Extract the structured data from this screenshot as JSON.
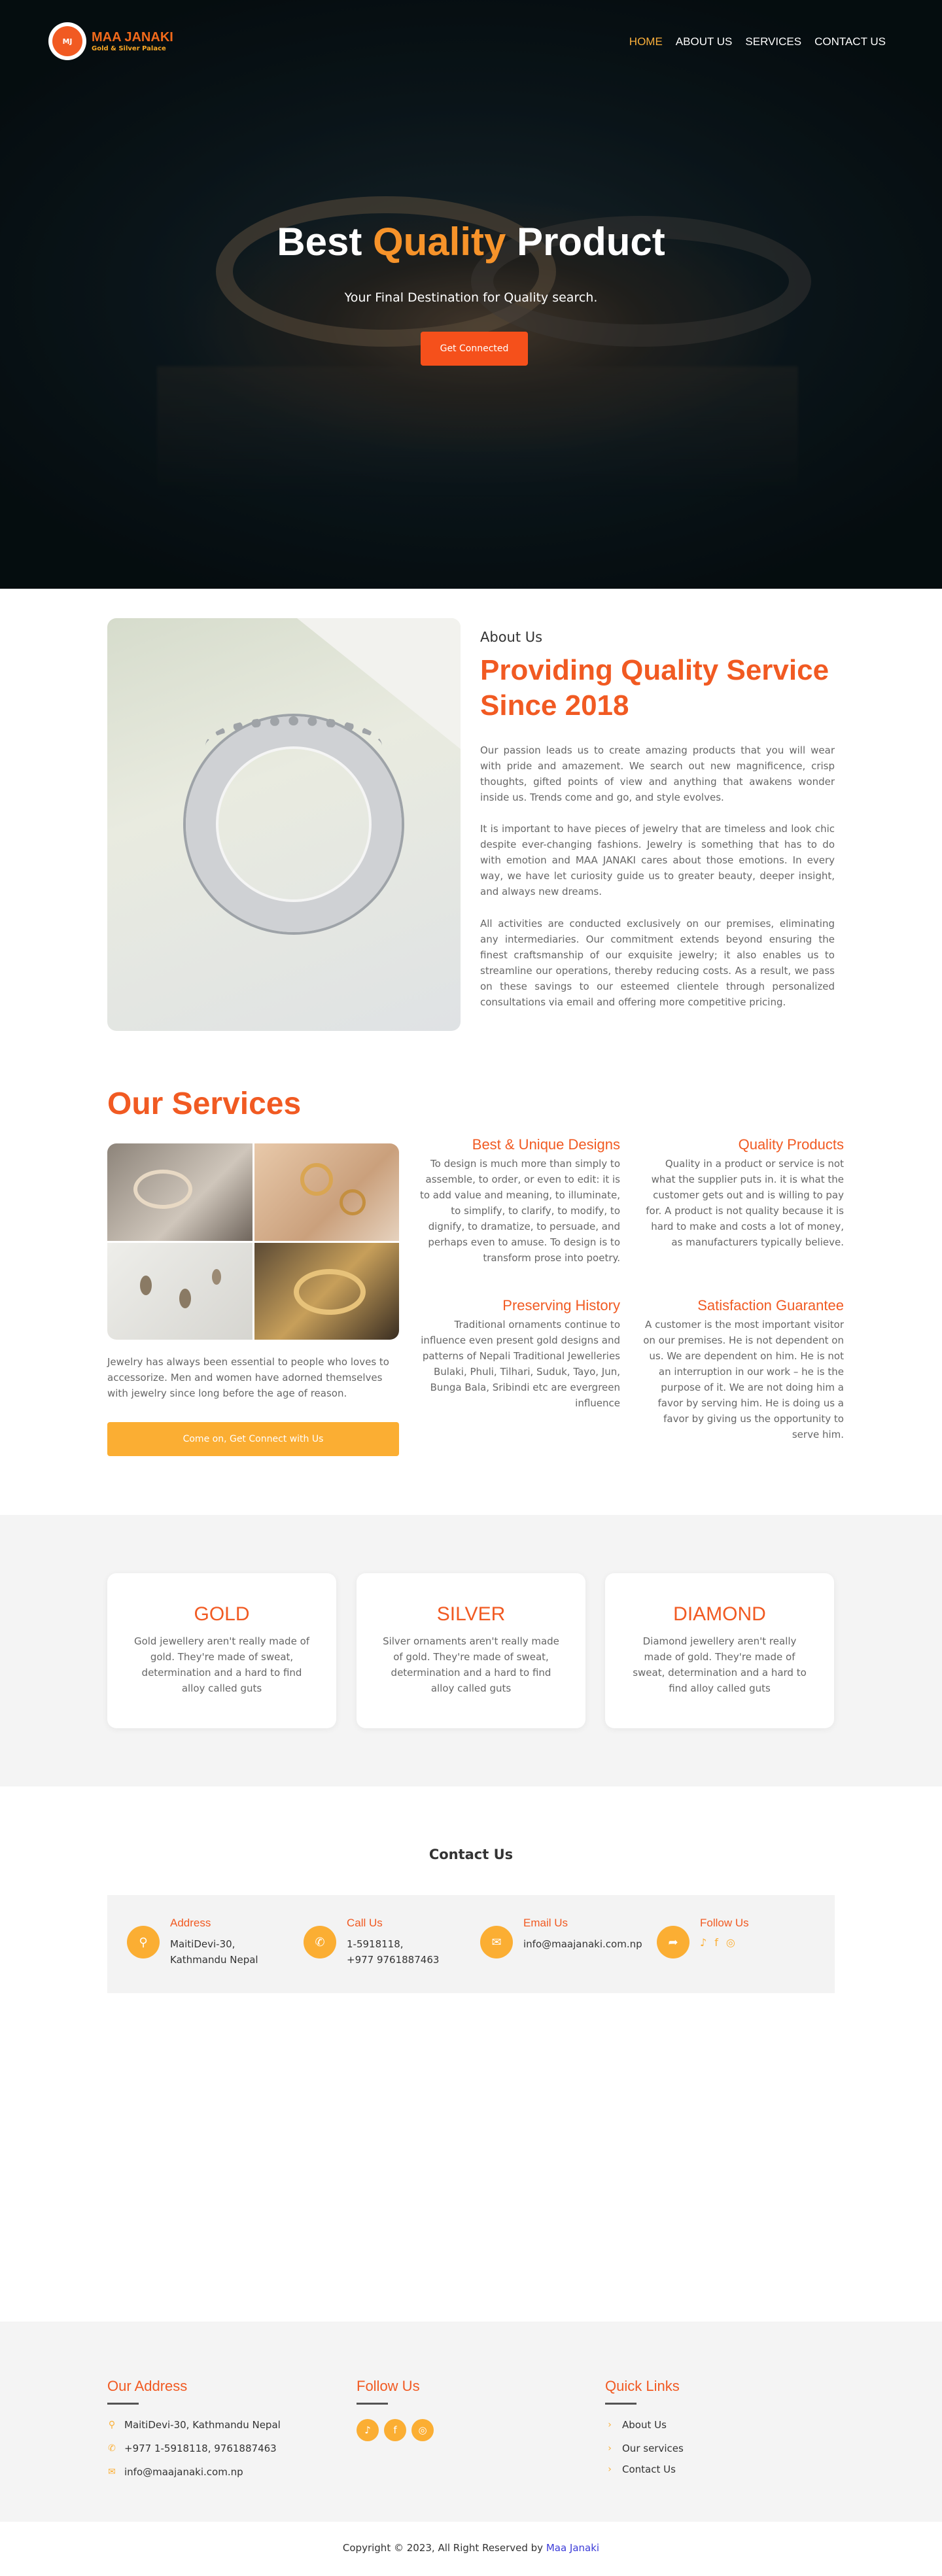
{
  "brand": {
    "name": "MAA JANAKI",
    "tagline": "Gold & Silver Palace",
    "badge": "MJ"
  },
  "nav": {
    "items": [
      "HOME",
      "ABOUT US",
      "SERVICES",
      "CONTACT US"
    ]
  },
  "hero": {
    "title_a": "Best ",
    "title_b": "Quality",
    "title_c": " Product",
    "subtitle": "Your Final Destination for Quality search.",
    "button": "Get Connected"
  },
  "about": {
    "kicker": "About Us",
    "title": "Providing Quality Service Since 2018",
    "paragraphs": [
      "Our passion leads us to create amazing products that you will wear with pride and amazement. We search out new magnificence, crisp thoughts, gifted points of view and anything that awakens wonder inside us. Trends come and go, and style evolves.",
      "It is important to have pieces of jewelry that are timeless and look chic despite ever-changing fashions. Jewelry is something that has to do with emotion and MAA JANAKI cares about those emotions. In every way, we have let curiosity guide us to greater beauty, deeper insight, and always new dreams.",
      "All activities are conducted exclusively on our premises, eliminating any intermediaries. Our commitment extends beyond ensuring the finest craftsmanship of our exquisite jewelry; it also enables us to streamline our operations, thereby reducing costs. As a result, we pass on these savings to our esteemed clientele through personalized consultations via email and offering more competitive pricing."
    ]
  },
  "services": {
    "title": "Our Services",
    "left_text": "Jewelry has always been essential to people who loves to accessorize. Men and women have adorned themselves with jewelry since long before the age of reason.",
    "button": "Come on, Get Connect with Us",
    "features": [
      {
        "title": "Best & Unique Designs",
        "text": "To design is much more than simply to assemble, to order, or even to edit: it is to add value and meaning, to illuminate, to simplify, to clarify, to modify, to dignify, to dramatize, to persuade, and perhaps even to amuse. To design is to transform prose into poetry."
      },
      {
        "title": "Quality Products",
        "text": "Quality in a product or service is not what the supplier puts in. it is what the customer gets out and is willing to pay for. A product is not quality because it is hard to make and costs a lot of money, as manufacturers typically believe."
      },
      {
        "title": "Preserving History",
        "text": "Traditional ornaments continue to influence even present gold designs and patterns of Nepali Traditional Jewelleries Bulaki, Phuli, Tilhari, Suduk, Tayo, Jun, Bunga Bala, Sribindi etc are evergreen influence"
      },
      {
        "title": "Satisfaction Guarantee",
        "text": "A customer is the most important visitor on our premises. He is not dependent on us. We are dependent on him. He is not an interruption in our work – he is the purpose of it. We are not doing him a favor by serving him. He is doing us a favor by giving us the opportunity to serve him."
      }
    ]
  },
  "categories": [
    {
      "title": "GOLD",
      "text": "Gold jewellery aren't really made of gold. They're made of sweat, determination and a hard to find alloy called guts"
    },
    {
      "title": "SILVER",
      "text": "Silver ornaments aren't really made of gold. They're made of sweat, determination and a hard to find alloy called guts"
    },
    {
      "title": "DIAMOND",
      "text": "Diamond jewellery aren't really made of gold. They're made of sweat, determination and a hard to find alloy called guts"
    }
  ],
  "contact": {
    "title": "Contact Us",
    "address": {
      "label": "Address",
      "line1": "MaitiDevi-30,",
      "line2": "Kathmandu Nepal"
    },
    "call": {
      "label": "Call Us",
      "line1": "1-5918118,",
      "line2": "+977 9761887463"
    },
    "email": {
      "label": "Email Us",
      "value": "info@maajanaki.com.np"
    },
    "follow": {
      "label": "Follow Us"
    }
  },
  "footer": {
    "address_title": "Our Address",
    "address": "MaitiDevi-30, Kathmandu Nepal",
    "phone": "+977 1-5918118, 9761887463",
    "email": "info@maajanaki.com.np",
    "follow_title": "Follow Us",
    "links_title": "Quick Links",
    "links": [
      "About Us",
      "Our services",
      "Contact Us"
    ],
    "copyright": "Copyright © 2023, All Right Reserved by ",
    "copyright_link": "Maa Janaki"
  },
  "colors": {
    "accent": "#f15a22",
    "gold": "#fbae33",
    "hero_button": "#f5501b"
  }
}
